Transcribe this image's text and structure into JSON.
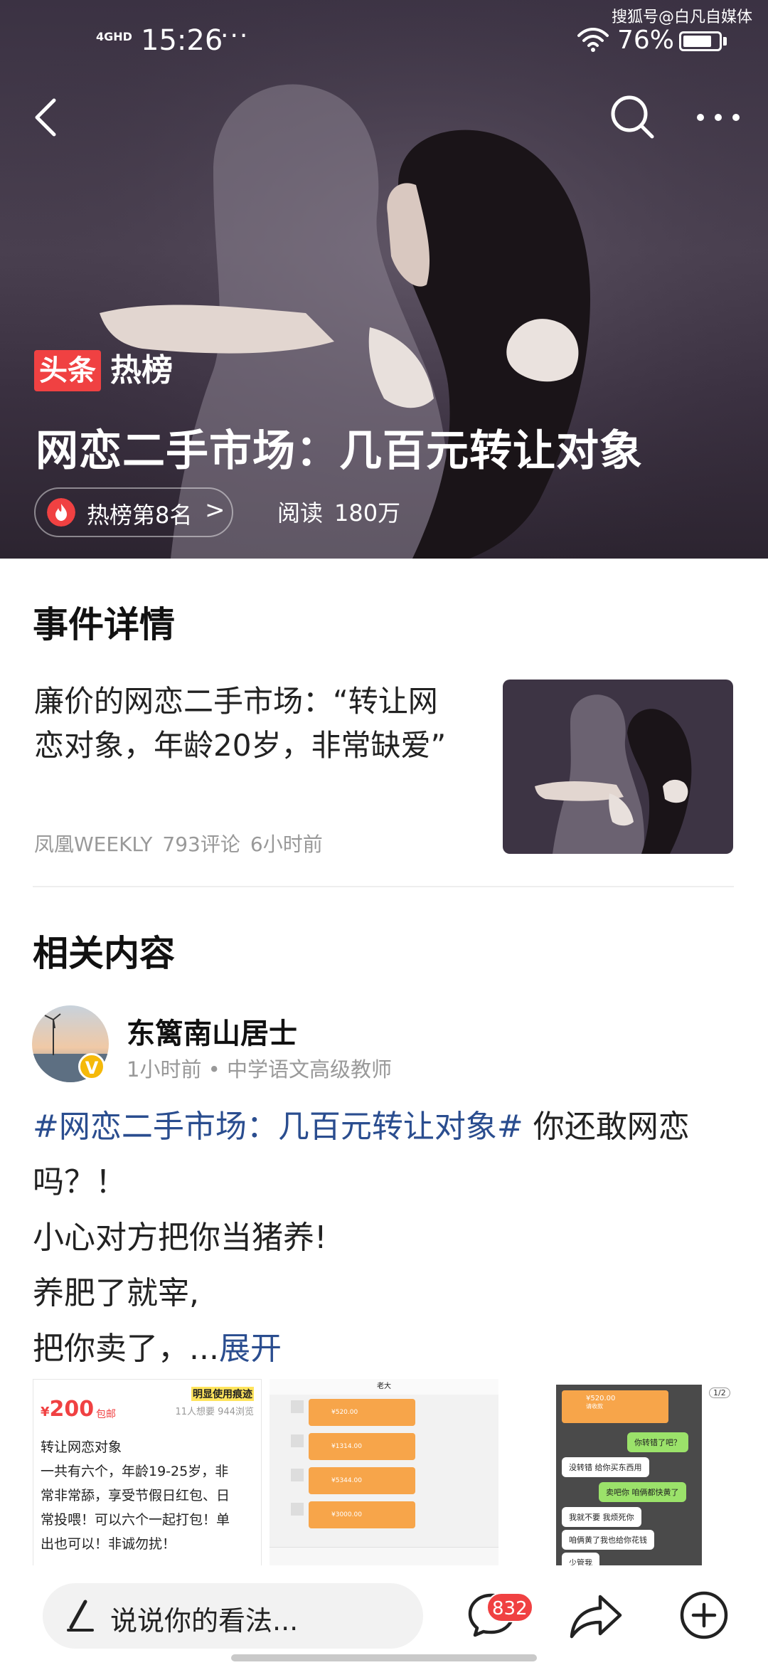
{
  "watermark": "搜狐号@白凡自媒体",
  "status_bar": {
    "network": "4GHD",
    "time": "15:26",
    "dots": "···",
    "battery_percent": "76%"
  },
  "hero": {
    "brand_box": "头条",
    "brand_text": "热榜",
    "title": "网恋二手市场：几百元转让对象",
    "rank_label": "热榜第8名",
    "rank_chevron": ">",
    "reads_label": "阅读",
    "reads_value": "180万"
  },
  "event": {
    "section_title": "事件详情",
    "title": "廉价的网恋二手市场：“转让网恋对象，年龄20岁，非常缺爱”",
    "source": "凤凰WEEKLY",
    "comments": "793评论",
    "time": "6小时前"
  },
  "related": {
    "section_title": "相关内容",
    "author": "东篱南山居士",
    "author_badge": "V",
    "author_meta": "1小时前 • 中学语文高级教师",
    "post": {
      "hashtag": "#网恋二手市场：几百元转让对象#",
      "line1_rest": " 你还敢网恋吗？！",
      "line2": "小心对方把你当猪养!",
      "line3": "养肥了就宰,",
      "line4": "把你卖了，...",
      "expand": "展开"
    },
    "images": {
      "listing": {
        "price_symbol": "¥",
        "price": "200",
        "shipping": "包邮",
        "highlight": "明显使用痕迹",
        "stats": "11人想要 944浏览",
        "lines": [
          "转让网恋对象",
          "一共有六个，年龄19-25岁，非",
          "常非常舔，享受节假日红包、日",
          "常投喂！可以六个一起打包！单",
          "出也可以！非诚勿扰！"
        ]
      },
      "chat1": {
        "title": "老大",
        "transfers": [
          "¥520.00",
          "¥1314.00",
          "¥5344.00",
          "¥3000.00"
        ]
      },
      "chat2": {
        "counter": "1/2",
        "transfer": "¥520.00",
        "transfer_note": "请收款",
        "messages": [
          "你转错了吧？",
          "没转错 给你买东西用",
          "卖吧你 咱俩都快黄了",
          "我就不要 我烦死你",
          "咱俩黄了我也给你花钱",
          "少管我"
        ]
      }
    }
  },
  "bottom_bar": {
    "comment_placeholder": "说说你的看法...",
    "comment_count": "832"
  },
  "colors": {
    "accent_red": "#f04142",
    "link_blue": "#2a4d8f",
    "verified_gold": "#f5b90a"
  },
  "icons": [
    "back-arrow-icon",
    "search-icon",
    "more-icon",
    "fire-icon",
    "pen-icon",
    "comment-icon",
    "share-icon",
    "add-icon",
    "wifi-icon",
    "battery-icon"
  ]
}
